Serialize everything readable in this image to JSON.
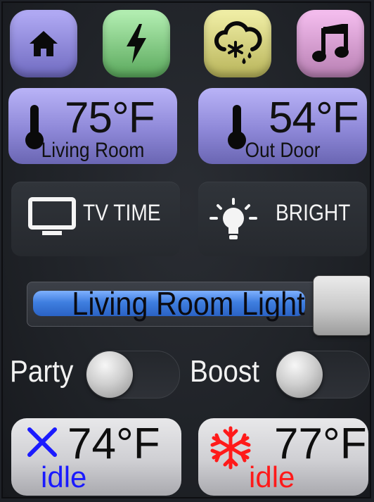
{
  "nav": {
    "buttons": [
      {
        "icon": "home-icon",
        "color": "#8f89dc"
      },
      {
        "icon": "lightning-icon",
        "color": "#7dc47f"
      },
      {
        "icon": "weather-snow-rain-icon",
        "color": "#d6d27e"
      },
      {
        "icon": "music-note-icon",
        "color": "#d89dd2"
      }
    ]
  },
  "temperatures": {
    "living": {
      "value": "75°F",
      "label": "Living Room"
    },
    "outdoor": {
      "value": "54°F",
      "label": "Out Door"
    }
  },
  "scenes": {
    "tv": {
      "label": "TV TIME",
      "icon": "tv-icon"
    },
    "bright": {
      "label": "BRIGHT",
      "icon": "lightbulb-icon"
    }
  },
  "light_slider": {
    "label": "Living Room Light",
    "level": 0.88,
    "fill_color": "#3f7fe0"
  },
  "toggles": {
    "party": {
      "label": "Party",
      "on": false
    },
    "boost": {
      "label": "Boost",
      "on": false
    }
  },
  "thermostats": {
    "left": {
      "temp": "74°F",
      "state": "idle",
      "icon": "close-x-icon",
      "color": "#1a1aff"
    },
    "right": {
      "temp": "77°F",
      "state": "idle",
      "icon": "snowflake-icon",
      "color": "#ff1a1a"
    }
  }
}
